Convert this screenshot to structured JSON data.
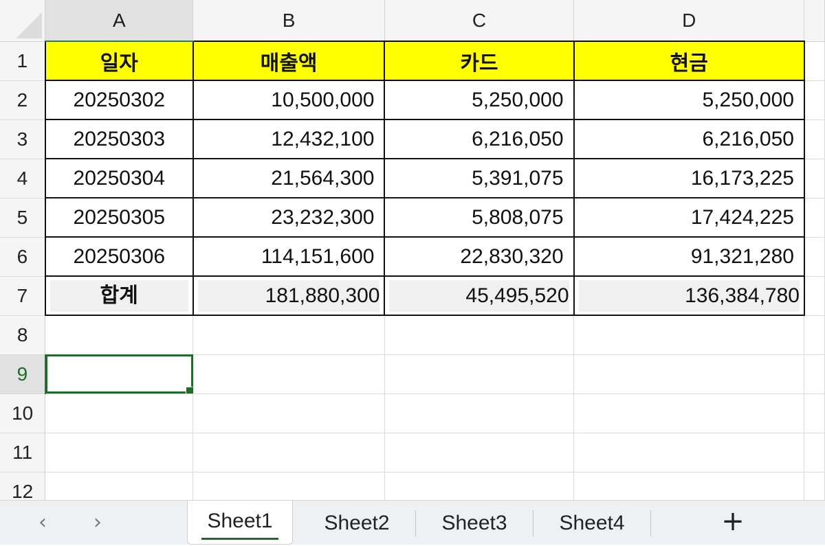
{
  "sheet": {
    "columns": [
      "A",
      "B",
      "C",
      "D"
    ],
    "rows": [
      "1",
      "2",
      "3",
      "4",
      "5",
      "6",
      "7",
      "8",
      "9",
      "10",
      "11",
      "12"
    ],
    "header": [
      "일자",
      "매출액",
      "카드",
      "현금"
    ],
    "data": [
      [
        "20250302",
        "10,500,000",
        "5,250,000",
        "5,250,000"
      ],
      [
        "20250303",
        "12,432,100",
        "6,216,050",
        "6,216,050"
      ],
      [
        "20250304",
        "21,564,300",
        "5,391,075",
        "16,173,225"
      ],
      [
        "20250305",
        "23,232,300",
        "5,808,075",
        "17,424,225"
      ],
      [
        "20250306",
        "114,151,600",
        "22,830,320",
        "91,321,280"
      ]
    ],
    "total": [
      "합계",
      "181,880,300",
      "45,495,520",
      "136,384,780"
    ],
    "selected_cell": "A9",
    "header_fill": "#ffff00",
    "selection_color": "#1e6b2a"
  },
  "tabs": {
    "prev_icon": "‹",
    "next_icon": "›",
    "items": [
      "Sheet1",
      "Sheet2",
      "Sheet3",
      "Sheet4"
    ],
    "active": "Sheet1",
    "add_label": "+"
  }
}
